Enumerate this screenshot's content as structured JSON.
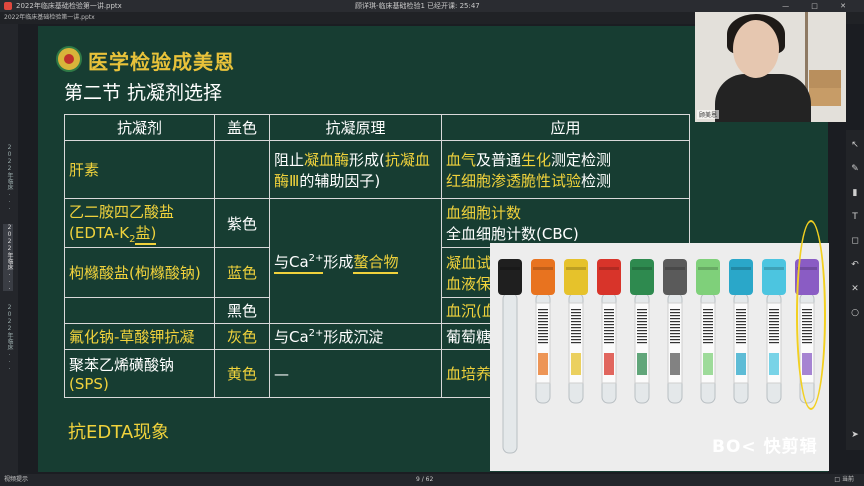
{
  "window": {
    "file_name": "2022年临床基础检验第一讲.pptx",
    "center_title": "顾详琪-临床基础检验1",
    "timer": "已经开课: 25:47",
    "controls": "— □ ✕"
  },
  "subbar": {
    "text": "2022年临床基础检验第一讲.pptx"
  },
  "left_rail": {
    "tabs": [
      {
        "label": "2022年临床...",
        "active": false
      },
      {
        "label": "2022年临床...",
        "active": true
      },
      {
        "label": "2022年临床...",
        "active": false
      }
    ]
  },
  "slide": {
    "brand": "医学检验成美恩",
    "title": "第二节  抗凝剂选择",
    "headers": [
      "抗凝剂",
      "盖色",
      "抗凝原理",
      "应用"
    ],
    "rows": {
      "heparin": {
        "name": "肝素",
        "color": "",
        "principle_parts": [
          "阻止",
          "凝血酶",
          "形成(",
          "抗凝血酶Ⅲ",
          "的辅助因子)"
        ],
        "app_line1": [
          "血气",
          "及普通",
          "生化",
          "测定检测"
        ],
        "app_line2": [
          "红细胞渗透脆性试验",
          "检测"
        ]
      },
      "edta": {
        "name_line1": "乙二胺四乙酸盐",
        "name_line2_pre": "(EDTA-K",
        "name_line2_sub": "2",
        "name_line2_post": "盐)",
        "color": "紫色",
        "app_line1": "血细胞计数",
        "app_line2": "全血细胞计数(CBC)"
      },
      "citrate": {
        "name": "枸橼酸盐(枸橼酸钠)",
        "color_a": "蓝色",
        "color_b": "黑色",
        "principle_pre": "与Ca",
        "principle_sup": "2+",
        "principle_mid": "形成",
        "principle_key": "螯合物",
        "app_a": "凝血试",
        "app_b": "血液保",
        "app_c": "血沉(血"
      },
      "fluoride": {
        "name": "氟化钠-草酸钾抗凝",
        "color": "灰色",
        "principle_pre": "与Ca",
        "principle_sup": "2+",
        "principle_post": "形成沉淀",
        "app": "葡萄糖"
      },
      "sps": {
        "name_line1": "聚苯乙烯磺酸钠",
        "name_line2": "(SPS)",
        "color": "黄色",
        "principle": "—",
        "app": "血培养"
      }
    },
    "footer_note": "抗EDTA现象"
  },
  "webcam": {
    "name": "顾美恩"
  },
  "photo": {
    "tubes": [
      {
        "cap": "#1f1f1f",
        "label": "plain"
      },
      {
        "cap": "#e8731f",
        "label": "barcode"
      },
      {
        "cap": "#e6c22b",
        "label": "barcode"
      },
      {
        "cap": "#d8342a",
        "label": "barcode"
      },
      {
        "cap": "#2e8a4f",
        "label": "barcode"
      },
      {
        "cap": "#5a5a5a",
        "label": "barcode"
      },
      {
        "cap": "#7fd07a",
        "label": "barcode"
      },
      {
        "cap": "#2aa7c9",
        "label": "barcode"
      },
      {
        "cap": "#4cc5e0",
        "label": "barcode"
      },
      {
        "cap": "#8a5cc4",
        "label": "barcode"
      }
    ]
  },
  "watermark": "BO< 快剪辑",
  "status": {
    "left": "视频提示",
    "pager": "9 / 62",
    "right": "□ 当前"
  },
  "colors": {
    "slide_bg": "#173d32",
    "highlight": "#f0d23c",
    "annotation": "#f2d020"
  }
}
